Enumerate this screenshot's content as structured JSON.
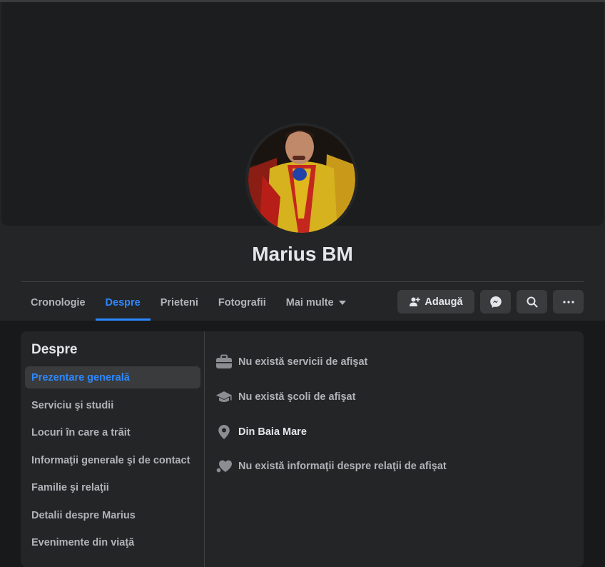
{
  "profile": {
    "name": "Marius BM"
  },
  "tabs": [
    {
      "label": "Cronologie"
    },
    {
      "label": "Despre",
      "active": true
    },
    {
      "label": "Prieteni"
    },
    {
      "label": "Fotografii"
    },
    {
      "label": "Mai multe"
    }
  ],
  "actions": {
    "add_label": "Adaugă"
  },
  "about": {
    "title": "Despre",
    "menu": [
      {
        "label": "Prezentare generală",
        "active": true
      },
      {
        "label": "Serviciu şi studii"
      },
      {
        "label": "Locuri în care a trăit"
      },
      {
        "label": "Informaţii generale şi de contact"
      },
      {
        "label": "Familie şi relaţii"
      },
      {
        "label": "Detalii despre Marius"
      },
      {
        "label": "Evenimente din viaţă"
      }
    ],
    "overview": [
      {
        "icon": "briefcase-icon",
        "text": "Nu există servicii de afişat"
      },
      {
        "icon": "graduation-cap-icon",
        "text": "Nu există şcoli de afişat"
      },
      {
        "icon": "location-pin-icon",
        "text": "Din Baia Mare"
      },
      {
        "icon": "heart-icon",
        "text": "Nu există informaţii despre relaţii de afişat"
      }
    ]
  },
  "colors": {
    "accent": "#2d88ff",
    "surface": "#242526",
    "background": "#18191a"
  }
}
